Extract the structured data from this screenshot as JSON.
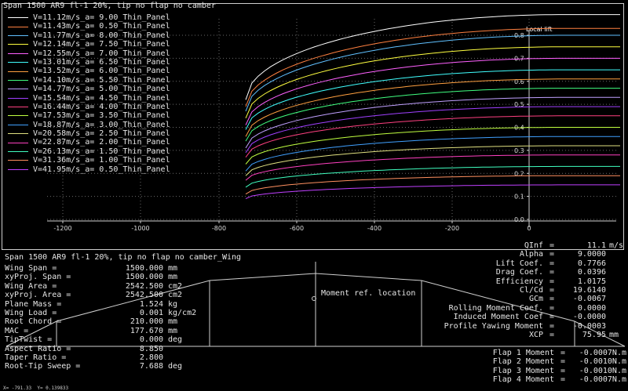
{
  "plot": {
    "title": "Span 1500 AR9 fl-1 20%, tip no flap no camber",
    "y_axis_label": "Local lift",
    "x_ticks": [
      "-1200",
      "-1000",
      "-800",
      "-600",
      "-400",
      "-200",
      "0"
    ],
    "y_ticks": [
      "0.0",
      "0.1",
      "0.2",
      "0.3",
      "0.4",
      "0.5",
      "0.6",
      "0.7",
      "0.8"
    ],
    "legend": [
      {
        "label": "V=11.12m/s_a= 9.00_Thin_Panel",
        "color": "#ffffff"
      },
      {
        "label": "V=11.43m/s_a= 0.50_Thin_Panel",
        "color": "#ff8040"
      },
      {
        "label": "V=11.77m/s_a= 8.00_Thin_Panel",
        "color": "#60c0ff"
      },
      {
        "label": "V=12.14m/s_a= 7.50_Thin_Panel",
        "color": "#ffff40"
      },
      {
        "label": "V=12.55m/s_a= 7.00_Thin_Panel",
        "color": "#ff60ff"
      },
      {
        "label": "V=13.01m/s_a= 6.50_Thin_Panel",
        "color": "#40ffff"
      },
      {
        "label": "V=13.52m/s_a= 6.00_Thin_Panel",
        "color": "#ffa040"
      },
      {
        "label": "V=14.10m/s_a= 5.50_Thin_Panel",
        "color": "#40ff80"
      },
      {
        "label": "V=14.77m/s_a= 5.00_Thin_Panel",
        "color": "#c0a0ff"
      },
      {
        "label": "V=15.54m/s_a= 4.50_Thin_Panel",
        "color": "#a040ff"
      },
      {
        "label": "V=16.44m/s_a= 4.00_Thin_Panel",
        "color": "#ff4080"
      },
      {
        "label": "V=17.53m/s_a= 3.50_Thin_Panel",
        "color": "#c0ff40"
      },
      {
        "label": "V=18.87m/s_a= 3.00_Thin_Panel",
        "color": "#40a0ff"
      },
      {
        "label": "V=20.58m/s_a= 2.50_Thin_Panel",
        "color": "#e0e080"
      },
      {
        "label": "V=22.87m/s_a= 2.00_Thin_Panel",
        "color": "#ff40c0"
      },
      {
        "label": "V=26.13m/s_a= 1.50_Thin_Panel",
        "color": "#40ffc0"
      },
      {
        "label": "V=31.36m/s_a= 1.00_Thin_Panel",
        "color": "#ff9060"
      },
      {
        "label": "V=41.95m/s_a= 0.50_Thin_Panel",
        "color": "#c040ff"
      }
    ]
  },
  "wing": {
    "title": "Span 1500 AR9 fl-1 20%, tip no flap no camber_Wing",
    "moment_ref_label": "Moment ref. location",
    "properties": [
      {
        "label": "Wing Span =",
        "value": "1500.000",
        "unit": "mm"
      },
      {
        "label": "xyProj. Span =",
        "value": "1500.000",
        "unit": "mm"
      },
      {
        "label": "Wing Area =",
        "value": "2542.500",
        "unit": "cm2"
      },
      {
        "label": "xyProj. Area =",
        "value": "2542.500",
        "unit": "cm2"
      },
      {
        "label": "Plane Mass =",
        "value": "1.524",
        "unit": "kg"
      },
      {
        "label": "Wing Load =",
        "value": "0.001",
        "unit": "kg/cm2"
      },
      {
        "label": "Root Chord =",
        "value": "210.000",
        "unit": "mm"
      },
      {
        "label": "MAC =",
        "value": "177.670",
        "unit": "mm"
      },
      {
        "label": "TipTwist =",
        "value": "0.000",
        "unit": "deg"
      },
      {
        "label": "Aspect Ratio =",
        "value": "8.850",
        "unit": ""
      },
      {
        "label": "Taper Ratio =",
        "value": "2.800",
        "unit": ""
      },
      {
        "label": "Root-Tip Sweep =",
        "value": "7.688",
        "unit": "deg"
      }
    ]
  },
  "aero": [
    {
      "label": "QInf",
      "value": "11.1",
      "unit": "m/s"
    },
    {
      "label": "Alpha",
      "value": "9.0000",
      "unit": ""
    },
    {
      "label": "Lift Coef.",
      "value": "0.7766",
      "unit": ""
    },
    {
      "label": "Drag Coef.",
      "value": "0.0396",
      "unit": ""
    },
    {
      "label": "Efficiency",
      "value": "1.0175",
      "unit": ""
    },
    {
      "label": "Cl/Cd",
      "value": "19.6140",
      "unit": ""
    },
    {
      "label": "GCm",
      "value": "-0.0067",
      "unit": ""
    },
    {
      "label": "Rolling Moment Coef.",
      "value": "0.0000",
      "unit": ""
    },
    {
      "label": "Induced Moment Coef",
      "value": "-0.0000",
      "unit": ""
    },
    {
      "label": "Profile Yawing Moment",
      "value": "-0.0003",
      "unit": ""
    },
    {
      "label": "XCP",
      "value": "75.95",
      "unit": "mm"
    }
  ],
  "flaps": [
    {
      "label": "Flap 1 Moment",
      "value": "-0.0007N.m"
    },
    {
      "label": "Flap 2 Moment",
      "value": "-0.0010N.m"
    },
    {
      "label": "Flap 3 Moment",
      "value": "-0.0010N.m"
    },
    {
      "label": "Flap 4 Moment",
      "value": "-0.0007N.m"
    }
  ],
  "status": "X= -791.33  Y= 0.139833",
  "chart_data": {
    "type": "line",
    "title": "Span 1500 AR9 fl-1 20%, tip no flap no camber",
    "ylabel": "Local lift",
    "xlabel": "",
    "xlim": [
      -1290,
      0
    ],
    "ylim": [
      0,
      0.82
    ],
    "x_ticks": [
      -1200,
      -1000,
      -800,
      -600,
      -400,
      -200,
      0
    ],
    "y_ticks": [
      0,
      0.1,
      0.2,
      0.3,
      0.4,
      0.5,
      0.6,
      0.7,
      0.8
    ],
    "x": [
      -750,
      -700,
      -650,
      -600,
      -500,
      -400,
      -300,
      -200,
      -100,
      0
    ],
    "series_root_values": [
      0.89,
      0.83,
      0.8,
      0.75,
      0.7,
      0.65,
      0.61,
      0.57,
      0.53,
      0.49,
      0.45,
      0.4,
      0.36,
      0.32,
      0.28,
      0.23,
      0.19,
      0.15
    ],
    "series_tip_values": [
      0.52,
      0.49,
      0.47,
      0.44,
      0.41,
      0.39,
      0.36,
      0.34,
      0.31,
      0.29,
      0.27,
      0.24,
      0.21,
      0.19,
      0.17,
      0.14,
      0.11,
      0.09
    ]
  }
}
